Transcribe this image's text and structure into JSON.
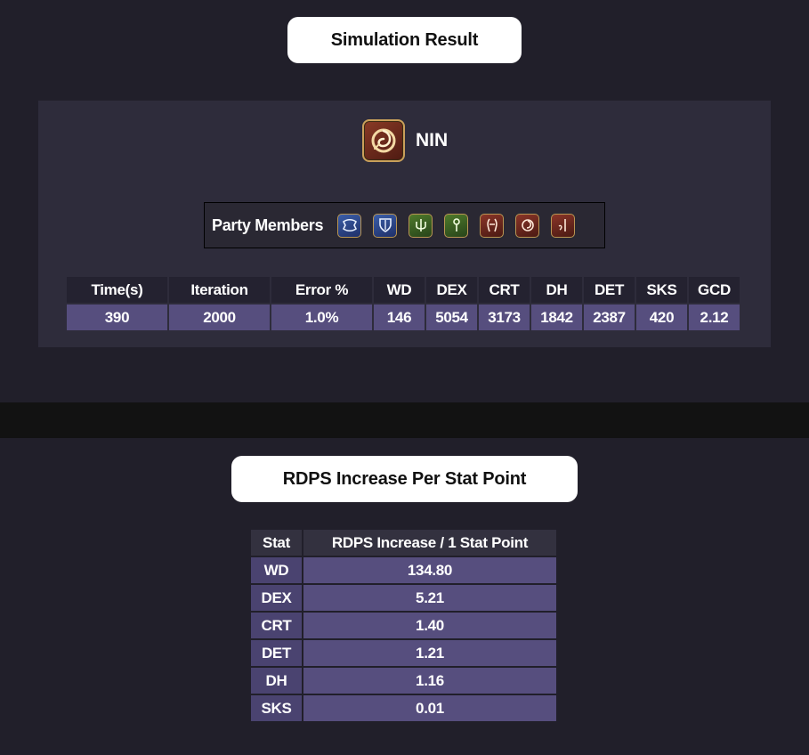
{
  "simulation": {
    "title": "Simulation Result",
    "job": {
      "name": "NIN",
      "icon": "ninja-job-icon"
    },
    "party": {
      "label": "Party Members",
      "members": [
        {
          "icon": "tank-job-icon-1",
          "role": "tank"
        },
        {
          "icon": "tank-job-icon-2",
          "role": "tank"
        },
        {
          "icon": "healer-job-icon-1",
          "role": "heal"
        },
        {
          "icon": "healer-job-icon-2",
          "role": "heal"
        },
        {
          "icon": "dps-job-icon-1",
          "role": "dps"
        },
        {
          "icon": "dps-job-icon-2",
          "role": "dps"
        },
        {
          "icon": "dps-job-icon-3",
          "role": "dps"
        }
      ]
    },
    "table": {
      "headers": [
        "Time(s)",
        "Iteration",
        "Error %",
        "WD",
        "DEX",
        "CRT",
        "DH",
        "DET",
        "SKS",
        "GCD"
      ],
      "values": [
        "390",
        "2000",
        "1.0%",
        "146",
        "5054",
        "3173",
        "1842",
        "2387",
        "420",
        "2.12"
      ]
    }
  },
  "rdps": {
    "title": "RDPS Increase Per Stat Point",
    "headers": [
      "Stat",
      "RDPS Increase / 1 Stat Point"
    ],
    "rows": [
      {
        "stat": "WD",
        "value": "134.80"
      },
      {
        "stat": "DEX",
        "value": "5.21"
      },
      {
        "stat": "CRT",
        "value": "1.40"
      },
      {
        "stat": "DET",
        "value": "1.21"
      },
      {
        "stat": "DH",
        "value": "1.16"
      },
      {
        "stat": "SKS",
        "value": "0.01"
      }
    ]
  },
  "colors": {
    "page_background": "#211f2a",
    "panel_background": "#2e2c3b",
    "cell_value": "#564e7e",
    "divider_band": "#121212"
  }
}
